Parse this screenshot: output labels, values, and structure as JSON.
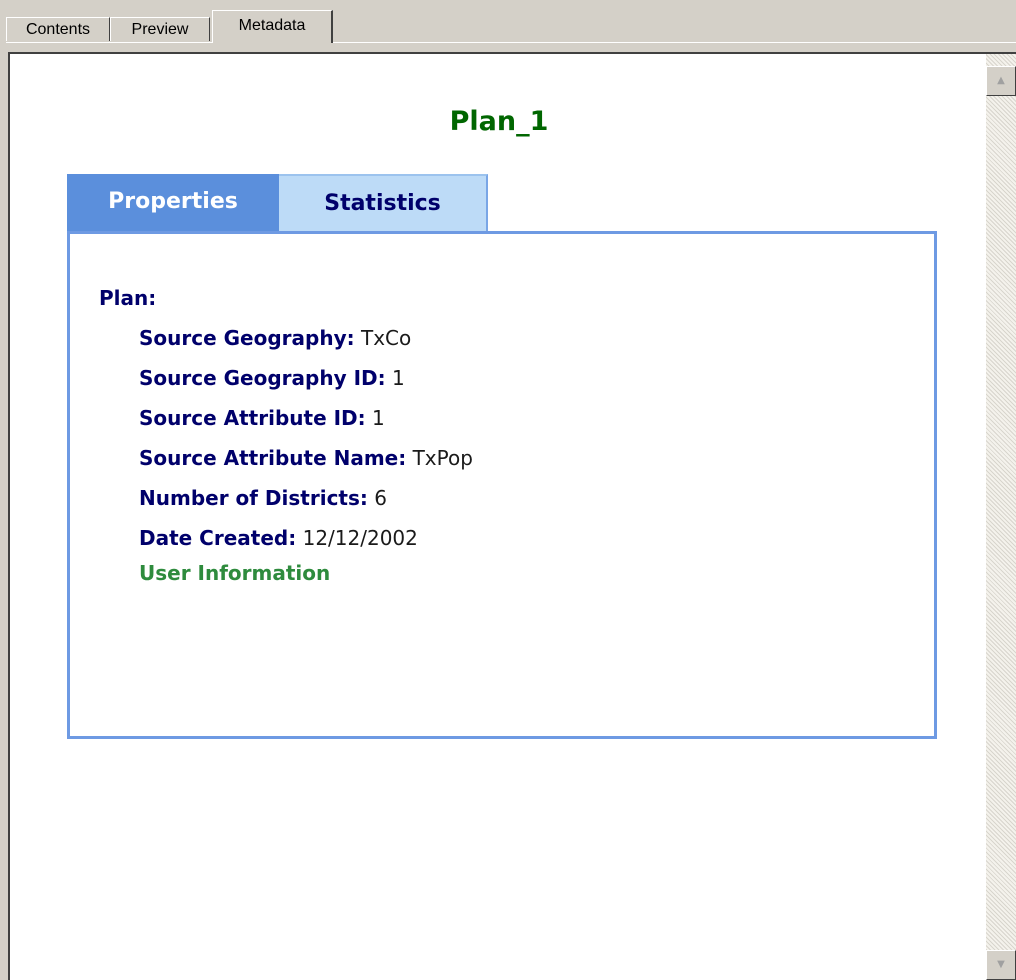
{
  "outer_tabs": [
    "Contents",
    "Preview",
    "Metadata"
  ],
  "document": {
    "title": "Plan_1",
    "tabs": {
      "properties": "Properties",
      "statistics": "Statistics"
    },
    "section_label": "Plan:",
    "properties": [
      {
        "key": "Source Geography:",
        "value": "TxCo"
      },
      {
        "key": "Source Geography ID:",
        "value": "1"
      },
      {
        "key": "Source Attribute ID:",
        "value": "1"
      },
      {
        "key": "Source Attribute Name:",
        "value": "TxPop"
      },
      {
        "key": "Number of Districts:",
        "value": "6"
      },
      {
        "key": "Date Created:",
        "value": "12/12/2002"
      }
    ],
    "user_info_link": "User Information"
  },
  "colors": {
    "title": "#006600",
    "label": "#00006b",
    "link": "#2e8b3d",
    "active_tab": "#5b8fdc",
    "inactive_tab": "#bddbf7"
  }
}
